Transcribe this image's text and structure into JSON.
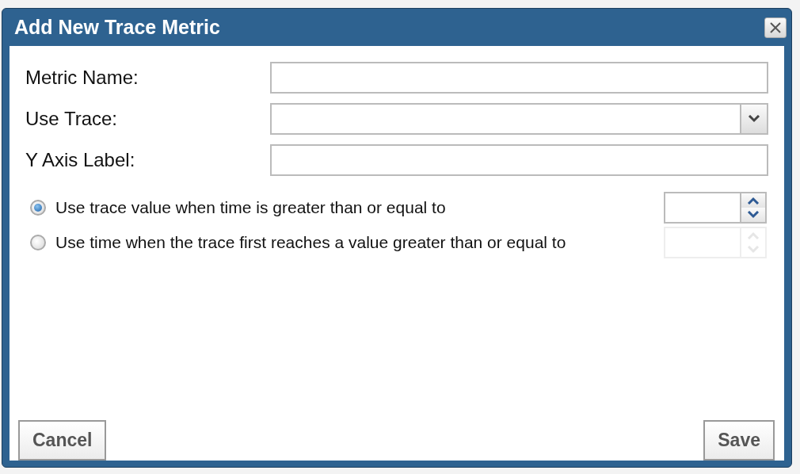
{
  "dialog": {
    "title": "Add New Trace Metric"
  },
  "fields": [
    {
      "label": "Metric Name:",
      "kind": "text"
    },
    {
      "label": "Use Trace:",
      "kind": "select"
    },
    {
      "label": "Y Axis Label:",
      "kind": "text"
    }
  ],
  "options": [
    {
      "label": "Use trace value when time is greater than or equal to",
      "selected": true,
      "disabled": false
    },
    {
      "label": "Use time when the trace first reaches a value greater than or equal to",
      "selected": false,
      "disabled": true
    }
  ],
  "buttons": [
    {
      "label": "Cancel"
    },
    {
      "label": "Save"
    }
  ]
}
